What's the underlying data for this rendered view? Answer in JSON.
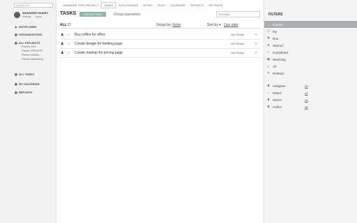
{
  "sidebar": {
    "search_placeholder": "Search for...",
    "profile": {
      "name": "ISKANDER HADIEV",
      "settings": "Settings",
      "logout": "Logout"
    },
    "invite_user": "INVITE USER",
    "organizations": "ORGANIZATIONS",
    "all_projects": "ALL PROJECTS",
    "projects": [
      "Planiro Dev",
      "Planiro PRIVATE",
      "Planiro Mobile",
      "Planiro Marketing"
    ],
    "all_tasks": "ALL TASKS",
    "my_calendar": "MY CALENDAR",
    "reports": "REPORTS"
  },
  "topnav": {
    "project": "ISKANDER TEST PROJECT",
    "tasks": "TASKS",
    "discussions": "DISCUSSIONS",
    "notes": "NOTES",
    "files": "FILES",
    "calendar": "CALENDAR",
    "reports": "REPORTS",
    "settings": "SETTINGS"
  },
  "main": {
    "title": "TASKS",
    "create_button": "CREATE TASK",
    "group_operations": "Group operations",
    "search_placeholder": "Find task",
    "all_label": "ALL",
    "group_by_label": "Group by",
    "group_by_value": "None",
    "sort_by_label": "Sort by",
    "sort_by_value": "Due date",
    "tasks": [
      {
        "title": "Buy coffee for office",
        "status": "Not Ready"
      },
      {
        "title": "Create design for landing page",
        "status": "Not Ready"
      },
      {
        "title": "Create markup for pricing page",
        "status": "Not Ready"
      }
    ]
  },
  "filters": {
    "title": "FILTERS",
    "items": [
      {
        "label": "Current",
        "icon": "arrow-right-icon"
      },
      {
        "label": "My",
        "icon": "checkbox-icon"
      },
      {
        "label": "Due",
        "icon": "flag-icon"
      },
      {
        "label": "Starred",
        "icon": "star-icon"
      },
      {
        "label": "Completed",
        "icon": "checkmark-icon"
      },
      {
        "label": "Watching",
        "icon": "eye-icon"
      },
      {
        "label": "All",
        "icon": "list-icon"
      },
      {
        "label": "Deleted",
        "icon": "trash-icon"
      }
    ],
    "people": [
      {
        "label": "Assignee",
        "value": "All",
        "icon": "person-icon"
      },
      {
        "label": "Status",
        "value": "All",
        "icon": "status-icon"
      },
      {
        "label": "Owner",
        "value": "All",
        "icon": "person-icon"
      },
      {
        "label": "Author",
        "value": "All",
        "icon": "person-icon"
      }
    ],
    "active_color": "#a8aeb4"
  },
  "colors": {
    "create_button": "#8db8a6",
    "sidebar_bg": "#f2f2f2",
    "filters_bg": "#f4f4f4"
  }
}
